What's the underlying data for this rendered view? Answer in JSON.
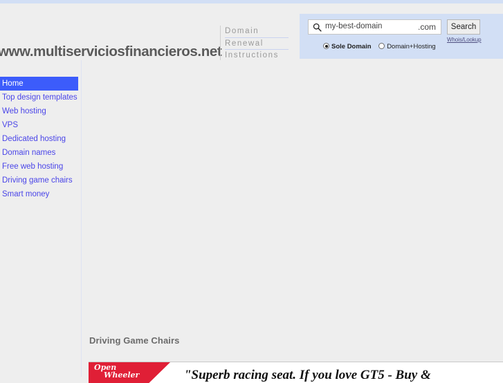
{
  "header": {
    "site_title": "www.multiserviciosfinancieros.net",
    "renewal_link": {
      "line1": "Domain",
      "line2": "Renewal",
      "line3": "Instructions"
    }
  },
  "search_panel": {
    "search_icon": "search-icon",
    "domain_value": "my-best-domain",
    "domain_placeholder": "my-best-domain",
    "tld_suffix": ".com",
    "search_button": "Search",
    "whois_link": "Whois/Lookup",
    "options": [
      {
        "label": "Sole Domain",
        "selected": true
      },
      {
        "label": "Domain+Hosting",
        "selected": false
      }
    ]
  },
  "sidebar": {
    "items": [
      {
        "label": "Home",
        "active": true
      },
      {
        "label": "Top design templates",
        "active": false
      },
      {
        "label": "Web hosting",
        "active": false
      },
      {
        "label": "VPS",
        "active": false
      },
      {
        "label": "Dedicated hosting",
        "active": false
      },
      {
        "label": "Domain names",
        "active": false
      },
      {
        "label": "Free web hosting",
        "active": false
      },
      {
        "label": "Driving game chairs",
        "active": false
      },
      {
        "label": "Smart money",
        "active": false
      }
    ]
  },
  "content": {
    "section_heading": "Driving Game Chairs",
    "promo": {
      "brand_line1": "Open",
      "brand_line2": "Wheeler",
      "headline": "\"Superb racing seat. If you love GT5 - Buy &"
    }
  },
  "colors": {
    "accent_blue": "#3c5cfb",
    "link_blue": "#4a45e8",
    "panel_blue": "#d2dff5",
    "page_bg": "#eeeeee",
    "promo_red": "#e01f36"
  }
}
